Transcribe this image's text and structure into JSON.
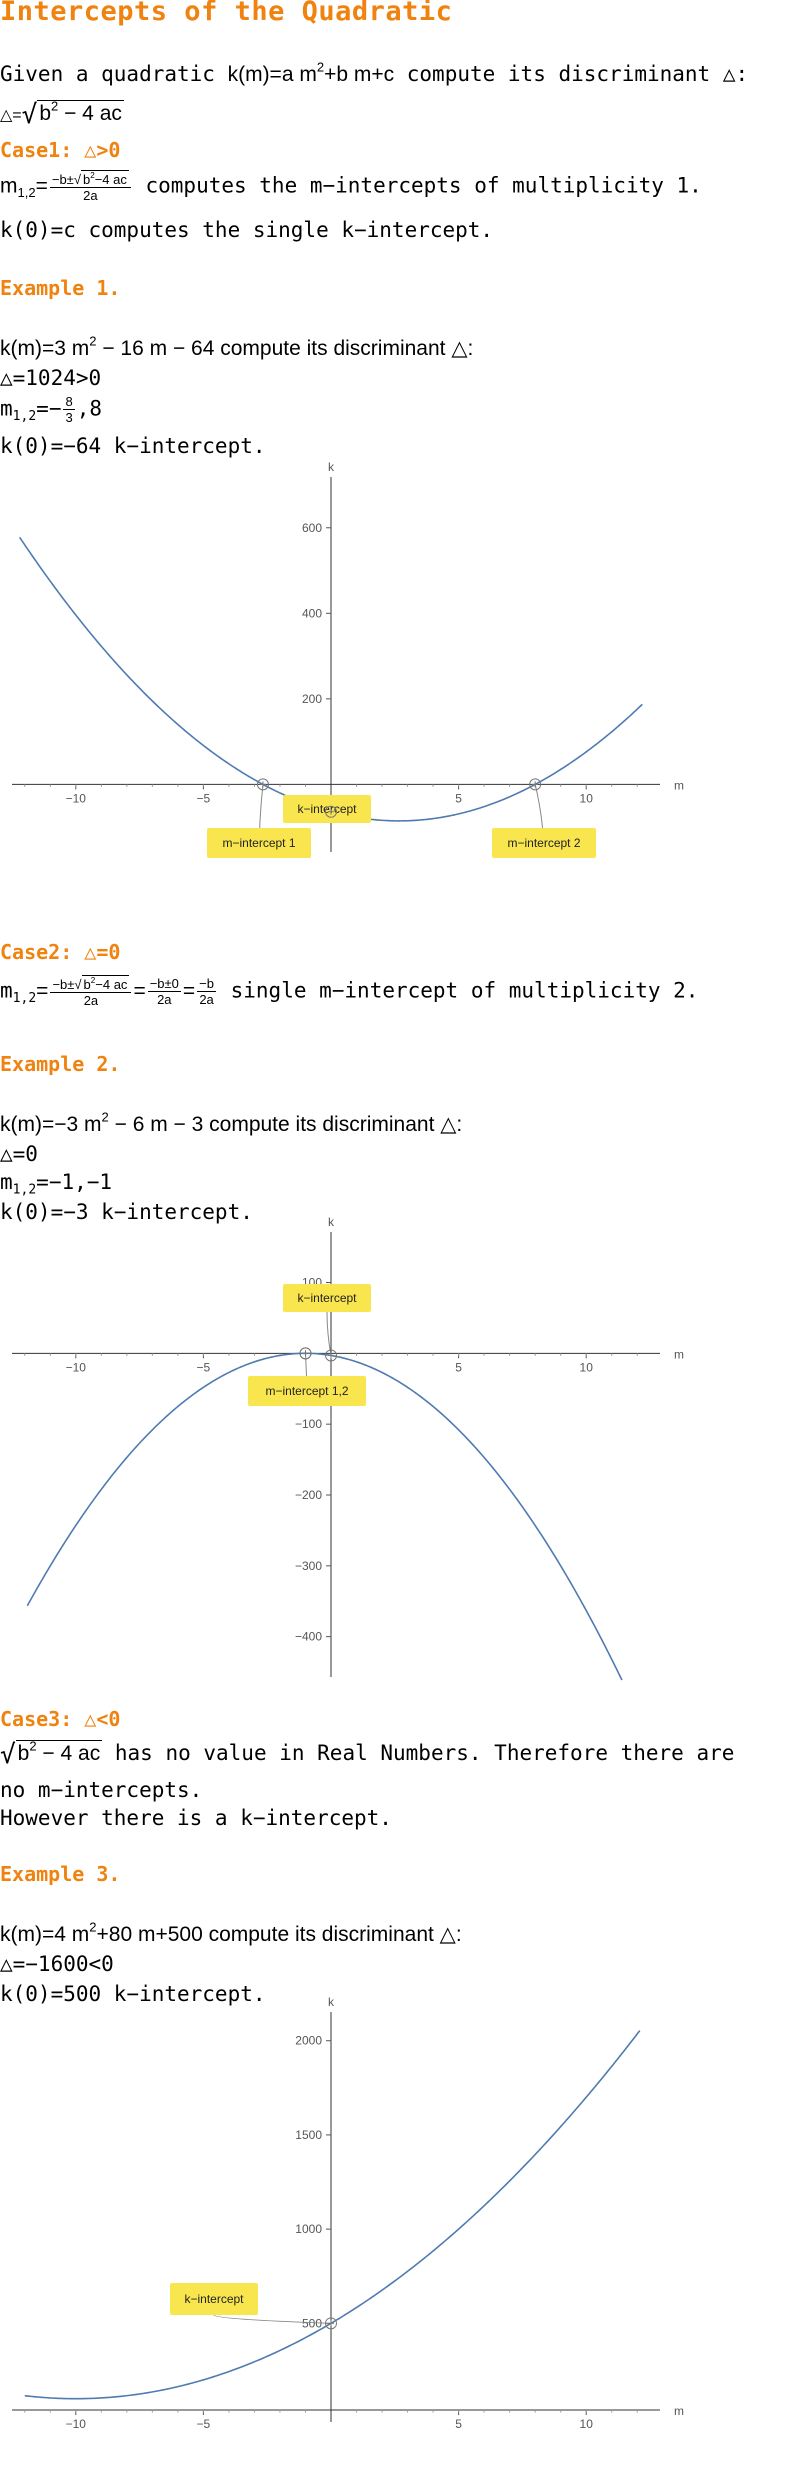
{
  "title": "Intercepts of the Quadratic",
  "intro": {
    "t1": "Given a quadratic ",
    "func": "k(m)=a m",
    "func2": "+b m+c",
    "t2": " compute its discriminant △:",
    "disc_lhs": "△=",
    "disc_rad": "b",
    "disc_rad2": " − 4 ac"
  },
  "case1": {
    "heading": "Case1: △>0",
    "m_lhs": "m",
    "m_sub": "1,2",
    "frac_num": "−b±",
    "frac_rad": "b",
    "frac_rad2": "−4 ac",
    "frac_den": "2a",
    "text1": " computes the m−intercepts of multiplicity 1.",
    "text2": "k(0)=c computes the single k−intercept."
  },
  "example1": {
    "heading": "Example 1.",
    "l1a": "k(m)=3 m",
    "l1b": " − 16 m − 64 compute its discriminant △:",
    "l2": "△=1024>0",
    "l3a": "m",
    "l3sub": "1,2",
    "l3b": "=−",
    "l3num": "8",
    "l3den": "3",
    "l3c": ",8",
    "l4": "k(0)=−64  k−intercept."
  },
  "case2": {
    "heading": "Case2: △=0",
    "m_lhs": "m",
    "m_sub": "1,2",
    "f1num": "−b±",
    "f1rad": "b",
    "f1rad2": "−4 ac",
    "f1den": "2a",
    "f2num": "−b±0",
    "f2den": "2a",
    "f3num": "−b",
    "f3den": "2a",
    "text": " single m−intercept of multiplicity 2."
  },
  "example2": {
    "heading": "Example 2.",
    "l1a": "k(m)=−3 m",
    "l1b": " − 6 m − 3 compute its discriminant △:",
    "l2": "△=0",
    "l3a": "m",
    "l3sub": "1,2",
    "l3b": "=−1,−1",
    "l4": "k(0)=−3  k−intercept."
  },
  "case3": {
    "heading": "Case3: △<0",
    "rad": "b",
    "rad2": " − 4 ac",
    "text1": "  has no value in Real Numbers. Therefore there are",
    "text2": "no m−intercepts.",
    "text3": "However there is a k−intercept."
  },
  "example3": {
    "heading": "Example 3.",
    "l1a": "k(m)=4 m",
    "l1b": "+80 m+500 compute its discriminant △:",
    "l2": "△=−1600<0",
    "l4": "k(0)=500 k−intercept."
  },
  "sup2": "2",
  "plot_axes": {
    "x_label": "m",
    "y_label": "k"
  },
  "colors": {
    "accent": "#f0820f",
    "curve": "#4f7bb0",
    "callout": "#f9e64f"
  },
  "plots": [
    {
      "id": "plot1",
      "a": 3,
      "b": -16,
      "c": -64,
      "xlim": [
        -12.5,
        12.5
      ],
      "ylim": [
        -130,
        700
      ],
      "xticks": [
        -10,
        -5,
        5,
        10
      ],
      "yticks": [
        200,
        400,
        600
      ],
      "labels": [
        "k−intercept",
        "m−intercept 1",
        "m−intercept 2"
      ]
    },
    {
      "id": "plot2",
      "a": -3,
      "b": -6,
      "c": -3,
      "xlim": [
        -12.5,
        12.5
      ],
      "ylim": [
        -440,
        160
      ],
      "xticks": [
        -10,
        -5,
        5,
        10
      ],
      "yticks": [
        100,
        -100,
        -200,
        -300,
        -400
      ],
      "labels": [
        "k−intercept",
        "m−intercept 1,2"
      ]
    },
    {
      "id": "plot3",
      "a": 4,
      "b": 80,
      "c": 500,
      "xlim": [
        -12.5,
        12.5
      ],
      "ylim": [
        40,
        2110
      ],
      "xticks": [
        -10,
        -5,
        5,
        10
      ],
      "yticks": [
        500,
        1000,
        1500,
        2000
      ],
      "labels": [
        "k−intercept"
      ]
    }
  ]
}
